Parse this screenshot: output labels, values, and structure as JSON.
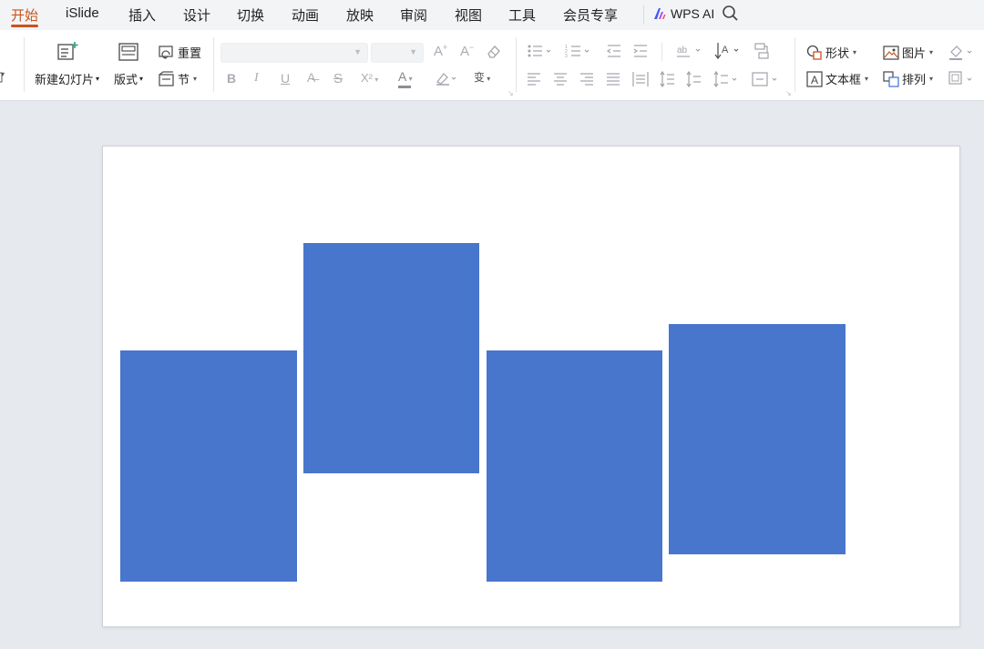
{
  "menu": {
    "tabs": [
      {
        "label": "开始",
        "active": true
      },
      {
        "label": "iSlide"
      },
      {
        "label": "插入"
      },
      {
        "label": "设计"
      },
      {
        "label": "切换"
      },
      {
        "label": "动画"
      },
      {
        "label": "放映"
      },
      {
        "label": "审阅"
      },
      {
        "label": "视图"
      },
      {
        "label": "工具"
      },
      {
        "label": "会员专享"
      }
    ],
    "wps_ai": "WPS AI",
    "accent_color": "#c9531b"
  },
  "toolbar": {
    "new_slide": "新建幻灯片",
    "layout": "版式",
    "reset": "重置",
    "section": "节",
    "shape": "形状",
    "picture": "图片",
    "textbox": "文本框",
    "arrange": "排列",
    "font_name": "",
    "font_size": "",
    "bold": "B",
    "italic": "I",
    "underline": "U",
    "strike": "S",
    "shadow_s": "S",
    "superscript": "X²",
    "font_color": "A"
  },
  "slide": {
    "shape_color": "#4876cd",
    "shape_count": 4
  }
}
